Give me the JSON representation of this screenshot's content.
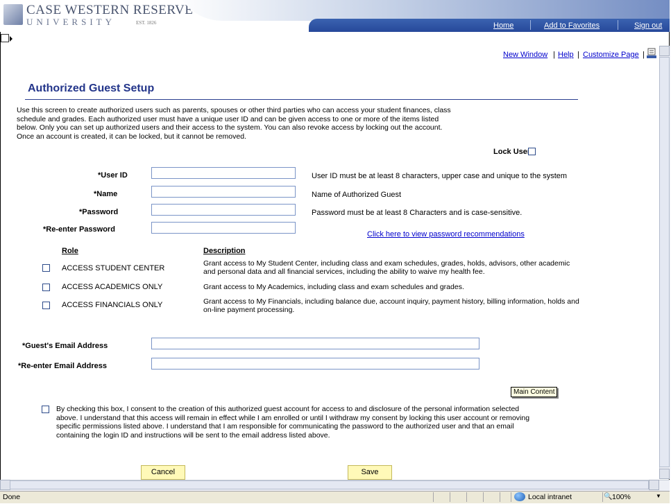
{
  "header": {
    "logo_line1": "CASE WESTERN RESERVE",
    "logo_line2": "UNIVERSITY",
    "logo_est": "EST. 1826",
    "nav": [
      "Home",
      "Add to Favorites",
      "Sign out"
    ]
  },
  "pagebar": {
    "new_window": "New Window",
    "help": "Help",
    "customize": "Customize Page",
    "sep": "|"
  },
  "page": {
    "title": "Authorized Guest Setup",
    "intro": "Use this screen to create authorized users such as parents, spouses or other third parties who can access your student finances, class schedule and grades. Each authorized user must have a unique user ID and can be given access to one or more of the items listed below. Only you can set up authorized users and their access to the system. You can also revoke access by locking out the account. Once an account is created, it can be locked, but it cannot be removed.",
    "lock_label": "Lock User?"
  },
  "fields": {
    "user_id": {
      "label": "*User ID",
      "value": "",
      "hint": "User ID must be at least 8 characters, upper case and unique to the system"
    },
    "name": {
      "label": "*Name",
      "value": "",
      "hint": "Name of Authorized Guest"
    },
    "password": {
      "label": "*Password",
      "value": "",
      "hint": "Password must be at least 8 Characters and is case-sensitive."
    },
    "password2": {
      "label": "*Re-enter Password",
      "value": ""
    },
    "password_link": "Click here to view password recommendations",
    "email": {
      "label": "*Guest's Email Address",
      "value": ""
    },
    "email2": {
      "label": "*Re-enter Email Address",
      "value": ""
    }
  },
  "roles": {
    "role_header": "Role",
    "desc_header": "Description",
    "items": [
      {
        "name": "ACCESS STUDENT CENTER",
        "desc": "Grant access to My Student Center, including class and exam schedules, grades, holds, advisors, other academic and personal data and all financial services, including the ability to waive my health fee."
      },
      {
        "name": "ACCESS ACADEMICS ONLY",
        "desc": "Grant access to My Academics, including class and exam schedules and grades."
      },
      {
        "name": "ACCESS FINANCIALS ONLY",
        "desc": "Grant access to My Financials, including balance due, account inquiry, payment history, billing information, holds and on-line payment processing."
      }
    ]
  },
  "consent": "By checking this box, I consent to the creation of this authorized guest account for access to and disclosure of the personal information selected above. I understand that this access will remain in effect while I am enrolled or until I withdraw my consent by locking this user account or removing specific permissions listed above. I understand that I am responsible for communicating the password to the authorized user and that an email containing the login ID and instructions will be sent to the email address listed above.",
  "tooltip": "Main Content",
  "buttons": {
    "cancel": "Cancel",
    "save": "Save"
  },
  "statusbar": {
    "status": "Done",
    "zone": "Local intranet",
    "zoom": "100%"
  }
}
